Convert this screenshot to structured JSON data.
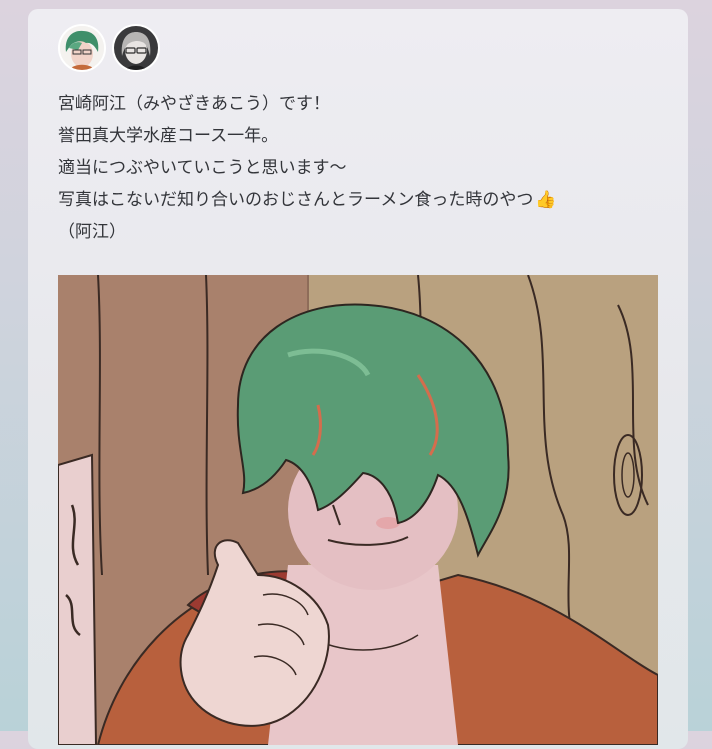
{
  "post": {
    "authors": [
      {
        "avatar_icon": "green-hair-character-avatar-icon"
      },
      {
        "avatar_icon": "gray-hair-glasses-character-avatar-icon"
      }
    ],
    "lines": [
      "宮崎阿江（みやざきあこう）です！",
      "誉田真大学水産コース一年。",
      "適当につぶやいていこうと思います〜",
      "写真はこないだ知り合いのおじさんとラーメン食った時のやつ",
      "（阿江）"
    ],
    "thumb_emoji": "👍",
    "image_icon": "green-hair-character-illustration-icon"
  }
}
